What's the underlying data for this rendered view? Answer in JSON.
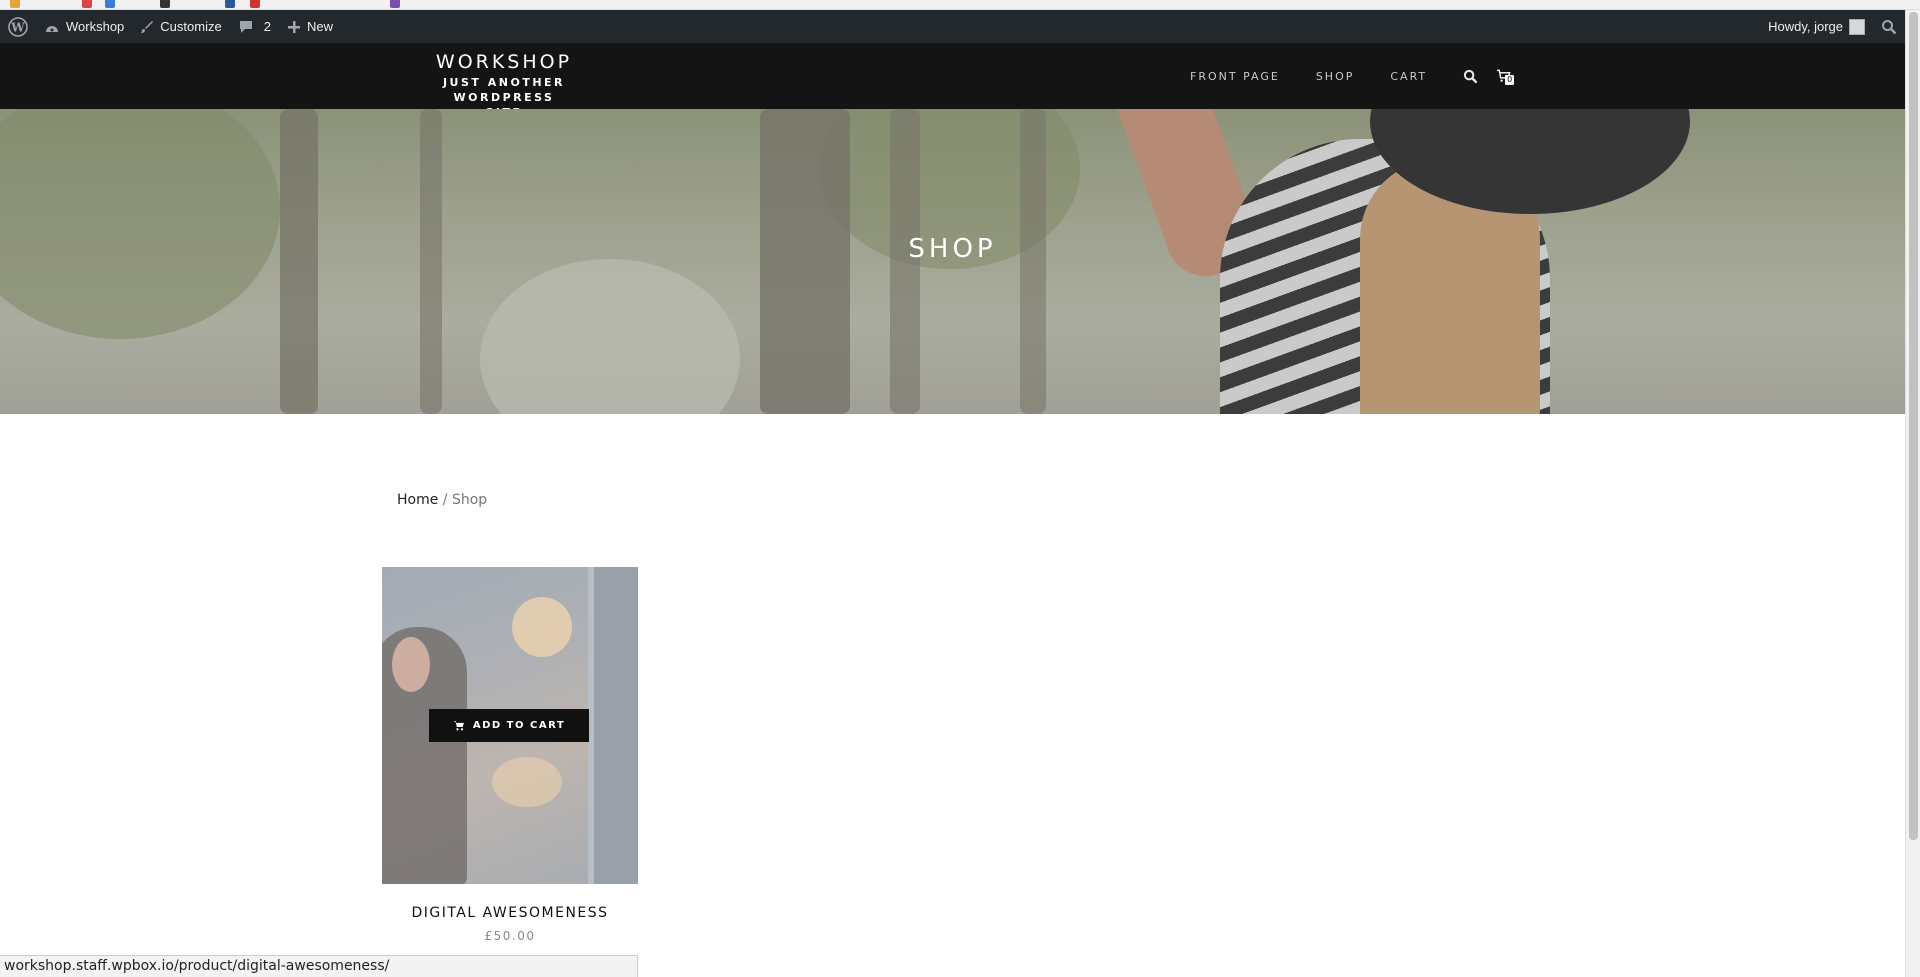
{
  "adminbar": {
    "site_name": "Workshop",
    "customize": "Customize",
    "comments_count": "2",
    "new_label": "New",
    "howdy": "Howdy, jorge"
  },
  "site": {
    "title": "WORKSHOP",
    "tagline_line1": "JUST ANOTHER WORDPRESS",
    "tagline_line2": "SITE"
  },
  "nav": {
    "items": [
      {
        "label": "FRONT PAGE"
      },
      {
        "label": "SHOP"
      },
      {
        "label": "CART"
      }
    ],
    "cart_count": "0"
  },
  "hero": {
    "title": "SHOP"
  },
  "breadcrumb": {
    "home": "Home",
    "separator": " / ",
    "current": "Shop"
  },
  "products": [
    {
      "name": "DIGITAL AWESOMENESS",
      "price": "£50.00",
      "add_to_cart": "ADD TO CART"
    }
  ],
  "status_bar": {
    "url": "workshop.staff.wpbox.io/product/digital-awesomeness/"
  },
  "colors": {
    "admin_bar": "#23282d",
    "header": "#141414",
    "button": "#111111"
  }
}
